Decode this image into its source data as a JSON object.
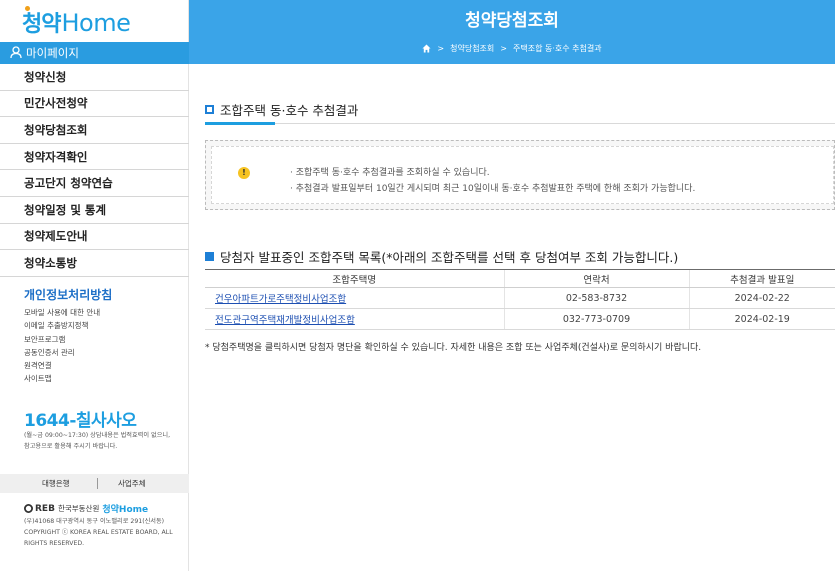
{
  "sidebar": {
    "logo_ko": "청약",
    "logo_en": "Home",
    "mypage": "마이페이지",
    "menu": [
      "청약신청",
      "민간사전청약",
      "청약당첨조회",
      "청약자격확인",
      "공고단지 청약연습",
      "청약일정 및 통계",
      "청약제도안내",
      "청약소통방"
    ],
    "privacy_title": "개인정보처리방침",
    "links": [
      "모바일 사용에 대한 안내",
      "이메일 추출방지정책",
      "보안프로그램",
      "공동인증서 관리",
      "원격연결",
      "사이트맵"
    ],
    "phone": "1644-칠사사오",
    "phone_info": "(월~금 09:00~17:30) 상담내용은 법적효력이 없으니, 참고용으로 활용해 주시기 바랍니다.",
    "bottom_left": "대행은행",
    "bottom_right": "사업주체",
    "footer_reb": "REB",
    "footer_org": "한국부동산원",
    "footer_brand": "청약Home",
    "footer_addr": "(우)41068 대구광역시 동구 이노밸리로 291(신서동) COPYRIGHT ⓒ KOREA REAL ESTATE BOARD, ALL RIGHTS RESERVED."
  },
  "header": {
    "title": "청약당첨조회",
    "breadcrumb": [
      "청약당첨조회",
      "주택조합 동·호수 추첨결과"
    ]
  },
  "main": {
    "section1_title": "조합주택 동·호수 추첨결과",
    "notes": [
      "· 조합주택 동·호수 추첨결과를 조회하실 수 있습니다.",
      "· 추첨결과 발표일부터 10일간 게시되며 최근 10일이내 동·호수 추첨발표한 주택에 한해 조회가 가능합니다."
    ],
    "section2_title": "당첨자 발표중인 조합주택 목록(*아래의 조합주택를 선택 후 당첨여부 조회 가능합니다.)",
    "table": {
      "headers": [
        "조합주택명",
        "연락처",
        "추첨결과 발표일"
      ],
      "rows": [
        [
          "건우아파트가로주택정비사업조합",
          "02-583-8732",
          "2024-02-22"
        ],
        [
          "전도관구역주택재개발정비사업조합",
          "032-773-0709",
          "2024-02-19"
        ]
      ]
    },
    "table_note": "* 당첨주택명을 클릭하시면 당첨자 명단을 확인하실 수 있습니다. 자세한 내용은 조합 또는 사업주체(건설사)로 문의하시기 바랍니다."
  },
  "colors": {
    "header_bg": "#3aa4e8",
    "mypage_bg": "#2a9ce0",
    "link": "#1d4fb2",
    "privacy": "#1d6fc7"
  }
}
